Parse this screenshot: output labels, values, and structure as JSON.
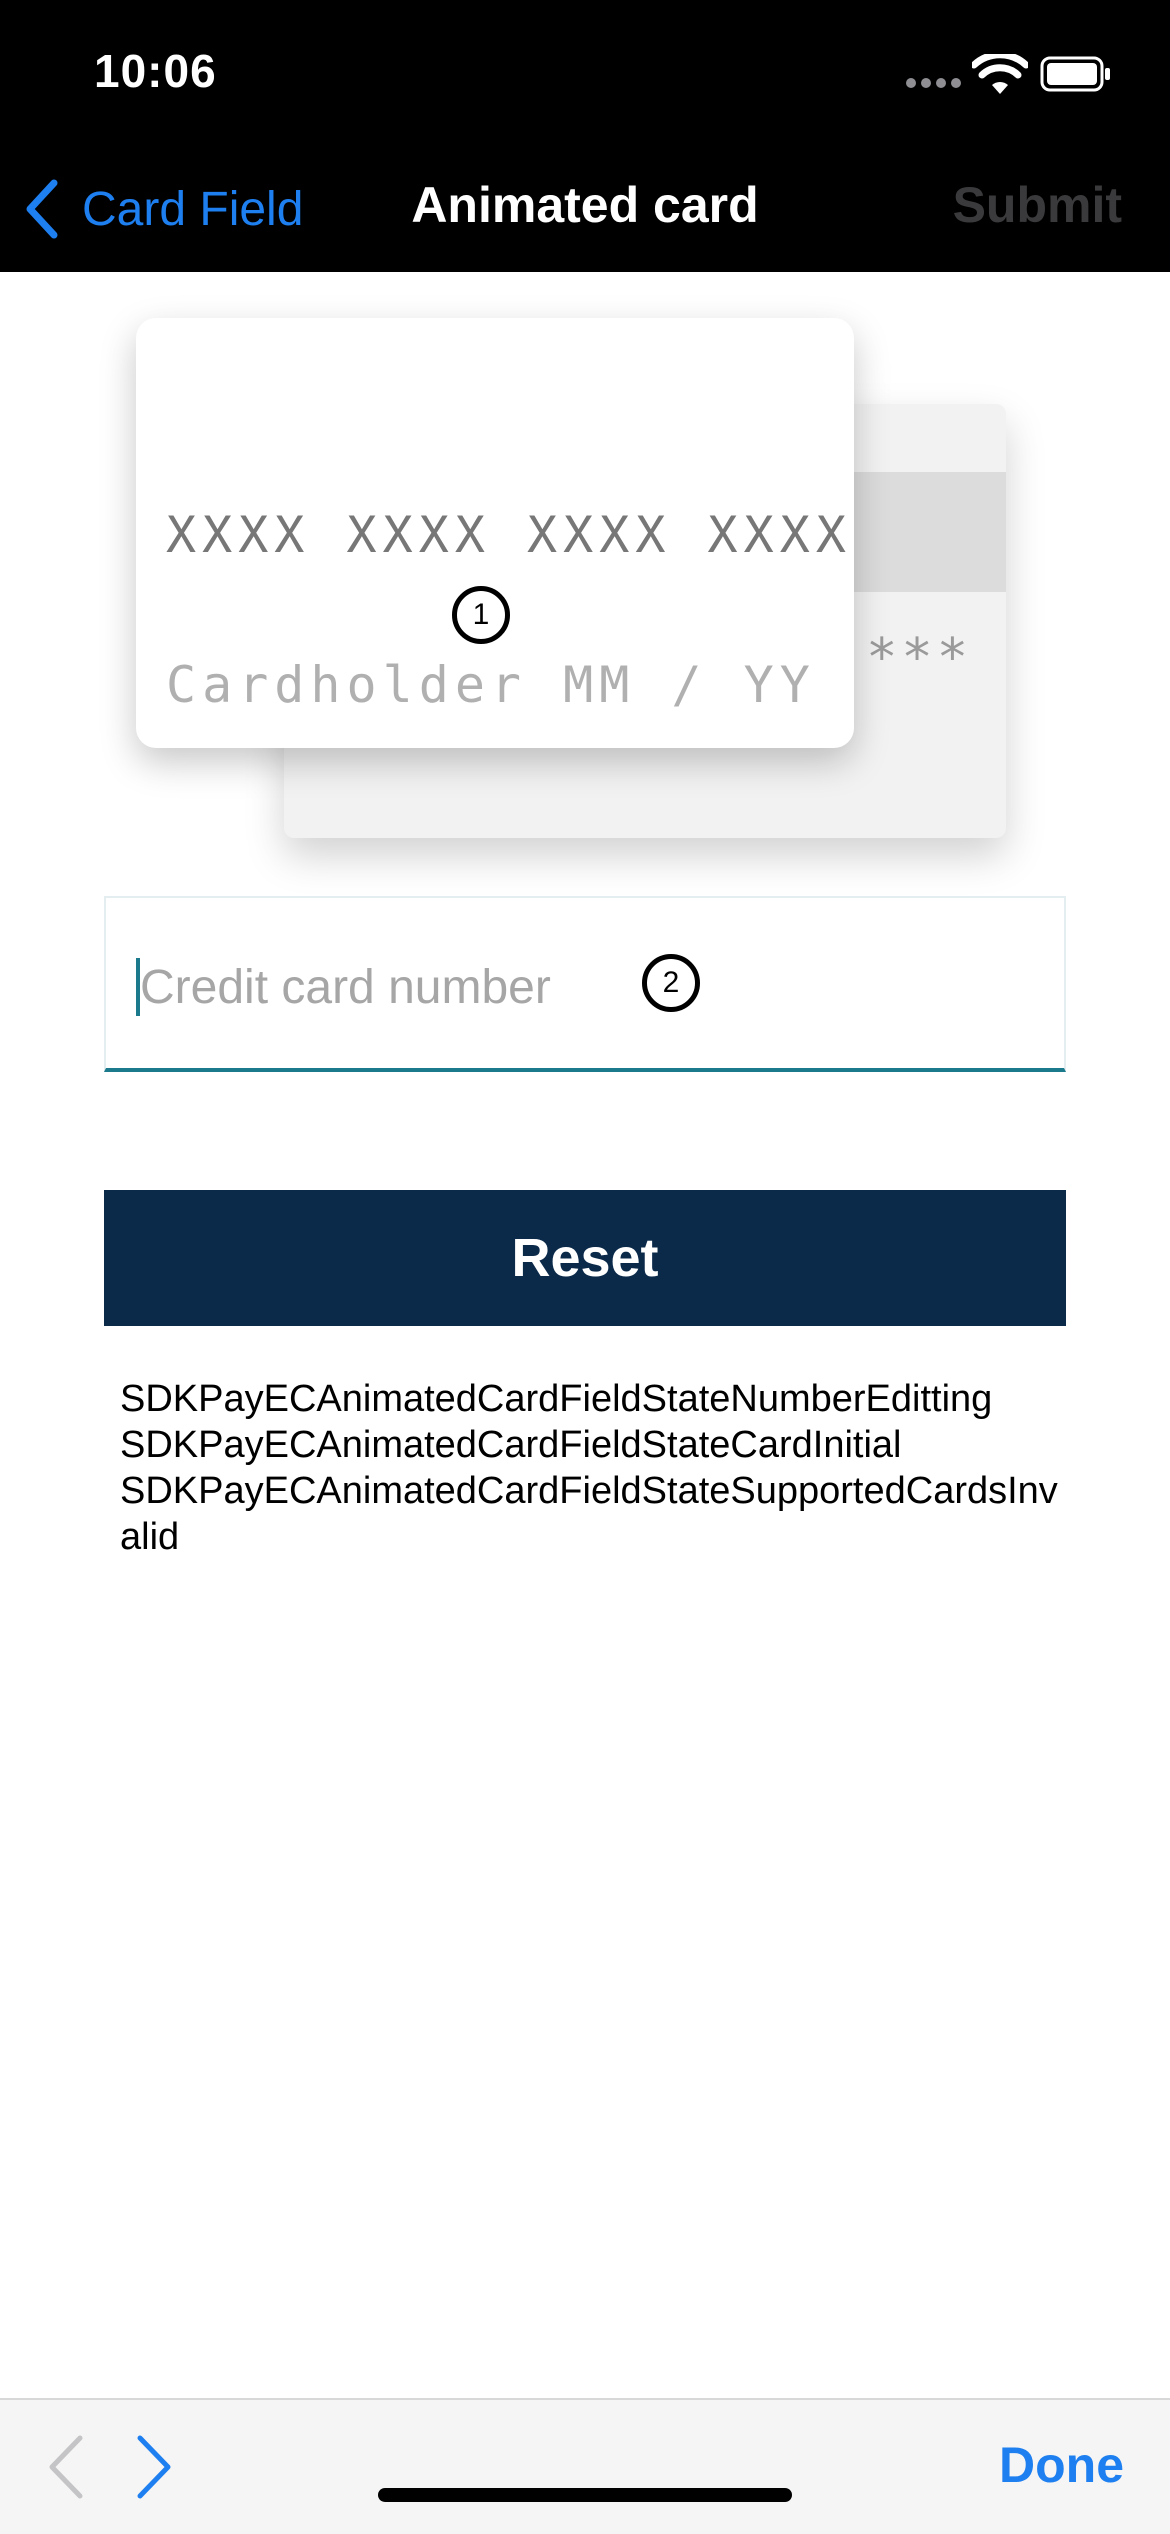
{
  "status_bar": {
    "time": "10:06"
  },
  "nav": {
    "back_label": "Card Field",
    "title": "Animated card",
    "submit_label": "Submit"
  },
  "card": {
    "number_placeholder": "XXXX XXXX XXXX XXXX",
    "holder_expiry": "Cardholder MM / YY",
    "cvv_mask": "***",
    "marker": "1"
  },
  "input": {
    "placeholder": "Credit card number",
    "value": "",
    "marker": "2"
  },
  "reset_label": "Reset",
  "states": [
    "SDKPayECAnimatedCardFieldStateNumberEditting",
    "SDKPayECAnimatedCardFieldStateCardInitial",
    "SDKPayECAnimatedCardFieldStateSupportedCardsInvalid"
  ],
  "toolbar": {
    "done_label": "Done"
  },
  "colors": {
    "accent": "#1e7ff0",
    "button": "#0b2a4a",
    "field_underline": "#1b7a8c"
  }
}
